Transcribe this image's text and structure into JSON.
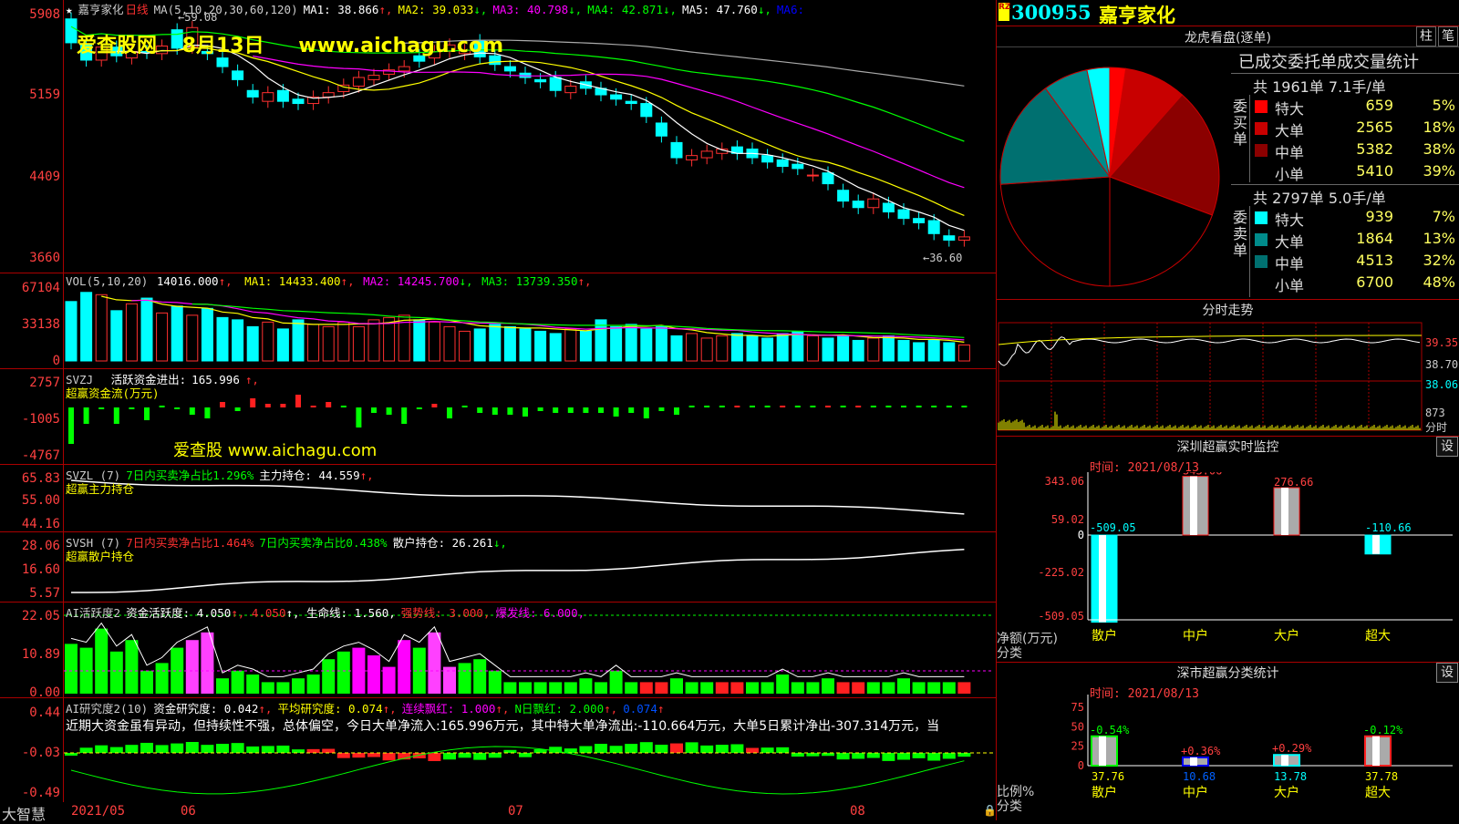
{
  "stock": {
    "code": "300955",
    "name": "嘉亨家化",
    "period": "日线",
    "badge": "RZ"
  },
  "watermark": {
    "site": "爱查股网",
    "date": "8月13日",
    "url": "www.aichagu.com",
    "url2": "爱查股 www.aichagu.com"
  },
  "price_panel": {
    "title": "嘉亨家化",
    "period": "日线",
    "ma_label": "MA(5,10,20,30,60,120)",
    "ma": [
      {
        "name": "MA1",
        "value": "38.866",
        "dir": "↑",
        "color": "#ffffff"
      },
      {
        "name": "MA2",
        "value": "39.033",
        "dir": "↓",
        "color": "#ffff00"
      },
      {
        "name": "MA3",
        "value": "40.798",
        "dir": "↓",
        "color": "#ff00ff"
      },
      {
        "name": "MA4",
        "value": "42.871",
        "dir": "↓",
        "color": "#00ff00"
      },
      {
        "name": "MA5",
        "value": "47.760",
        "dir": "↓",
        "color": "#ffffff"
      },
      {
        "name": "MA6",
        "value": "",
        "dir": "",
        "color": "#0000ff"
      }
    ],
    "high_label": "←59.08",
    "low_label": "←36.60",
    "y_labels": [
      "5908",
      "5159",
      "4409",
      "3660"
    ]
  },
  "vol_panel": {
    "label": "VOL(5,10,20)",
    "value": "14016.000",
    "ma": [
      {
        "name": "MA1",
        "value": "14433.400",
        "dir": "↑",
        "color": "#ffff00"
      },
      {
        "name": "MA2",
        "value": "14245.700",
        "dir": "↓",
        "color": "#ff00ff"
      },
      {
        "name": "MA3",
        "value": "13739.350",
        "dir": "↑",
        "color": "#00ff00"
      }
    ],
    "y_labels": [
      "67104",
      "33138",
      "0"
    ]
  },
  "svzj_panel": {
    "label": "SVZJ",
    "line1": "活跃资金进出:",
    "value": "165.996",
    "dir": "↑,",
    "subtitle": "超赢资金流(万元)",
    "y_labels": [
      "2757",
      "-1005",
      "-4767"
    ]
  },
  "svzl_panel": {
    "label": "SVZL (7)",
    "item1": "7日内买卖净占比1.296%",
    "item2": "主力持仓: 44.559",
    "dir": "↑,",
    "subtitle": "超赢主力持仓",
    "y_labels": [
      "65.83",
      "55.00",
      "44.16"
    ]
  },
  "svsh_panel": {
    "label": "SVSH (7)",
    "item1": "7日内买卖净占比1.464%",
    "item2": "7日内买卖净占比0.438%",
    "item3": "散户持仓: 26.261",
    "dir": "↓,",
    "subtitle": "超赢散户持仓",
    "y_labels": [
      "28.06",
      "16.60",
      "5.57"
    ]
  },
  "ai1_panel": {
    "label": "AI活跃度2",
    "item1": "资金活跃度: 4.050",
    "item1b": "↑, 4.050",
    "item2": "↑, 生命线: 1.560,",
    "item3": "强势线: 3.000,",
    "item4": "爆发线: 6.000,",
    "y_labels": [
      "22.05",
      "10.89",
      "0.00"
    ]
  },
  "ai2_panel": {
    "label": "AI研究度2(10)",
    "item1": "资金研究度: 0.042",
    "item1dir": "↑,",
    "item2": "平均研究度: 0.074",
    "item2dir": "↑,",
    "item3": "连续飘红: 1.000",
    "item3dir": "↑,",
    "item4": "N日飘红: 2.000",
    "item4dir": "↑,",
    "item5": "0.074",
    "item5dir": "↑",
    "comment": "近期大资金虽有异动，但持续性不强，总体偏空，今日大单净流入:165.996万元，其中特大单净流出:-110.664万元，大单5日累计净出-307.314万元，当",
    "y_labels": [
      "0.44",
      "-0.03",
      "-0.49"
    ]
  },
  "x_axis": {
    "labels": [
      "2021/05",
      "06",
      "07",
      "08"
    ],
    "brand": "大智慧"
  },
  "dragon_tiger": {
    "title": "龙虎看盘(逐单)",
    "tab1": "柱",
    "tab2": "笔",
    "stats_title": "已成交委托单成交量统计",
    "buy_header": "共 1961单 7.1手/单",
    "sell_header": "共 2797单 5.0手/单",
    "buy_side": "委买单",
    "sell_side": "委卖单",
    "buy_rows": [
      {
        "label": "特大",
        "qty": "659",
        "pct": "5%",
        "color": "#ff0000"
      },
      {
        "label": "大单",
        "qty": "2565",
        "pct": "18%",
        "color": "#c80000"
      },
      {
        "label": "中单",
        "qty": "5382",
        "pct": "38%",
        "color": "#8b0000"
      },
      {
        "label": "小单",
        "qty": "5410",
        "pct": "39%",
        "color": "#000000"
      }
    ],
    "sell_rows": [
      {
        "label": "特大",
        "qty": "939",
        "pct": "7%",
        "color": "#00ffff"
      },
      {
        "label": "大单",
        "qty": "1864",
        "pct": "13%",
        "color": "#008b8b"
      },
      {
        "label": "中单",
        "qty": "4513",
        "pct": "32%",
        "color": "#007070"
      },
      {
        "label": "小单",
        "qty": "6700",
        "pct": "48%",
        "color": "#000000"
      }
    ]
  },
  "intraday": {
    "title": "分时走势",
    "price_labels": [
      "39.35",
      "38.70",
      "38.06"
    ],
    "vol_label": "873",
    "vol_unit": "分时"
  },
  "monitor": {
    "title": "深圳超赢实时监控",
    "time": "时间: 2021/08/13",
    "set": "设",
    "y_labels": [
      "343.06",
      "59.02",
      "0",
      "-225.02",
      "-509.05"
    ],
    "y_unit1": "净额(万元)",
    "y_unit2": "分类",
    "categories": [
      "散户",
      "中户",
      "大户",
      "超大"
    ],
    "values": [
      -509.05,
      343.06,
      276.66,
      -110.66
    ],
    "value_labels": [
      "-509.05",
      "343.06",
      "276.66",
      "-110.66"
    ]
  },
  "classify": {
    "title": "深市超赢分类统计",
    "time": "时间: 2021/08/13",
    "set": "设",
    "y_labels": [
      "75",
      "50",
      "25",
      "0"
    ],
    "y_unit1": "比例%",
    "y_unit2": "分类",
    "categories": [
      "散户",
      "中户",
      "大户",
      "超大"
    ],
    "values": [
      37.76,
      10.68,
      13.78,
      37.78
    ],
    "value_labels": [
      "37.76",
      "10.68",
      "13.78",
      "37.78"
    ],
    "changes": [
      "-0.54%",
      "+0.36%",
      "+0.29%",
      "-0.12%"
    ]
  }
}
